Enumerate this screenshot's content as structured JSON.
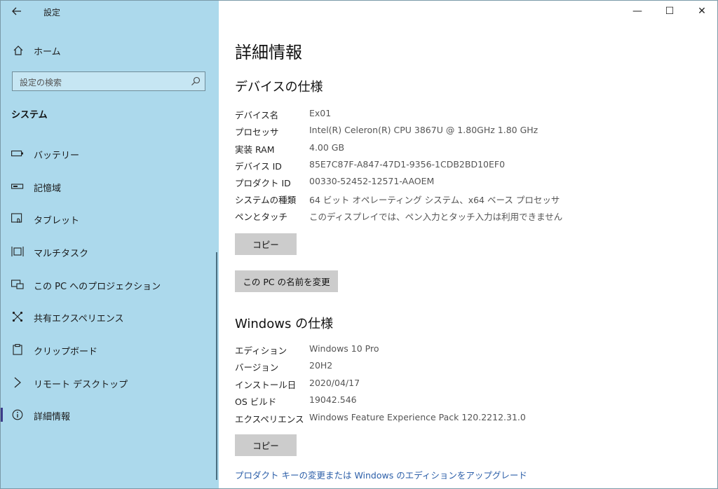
{
  "sidebar": {
    "back_icon": "back-arrow-icon",
    "app_title": "設定",
    "home_label": "ホーム",
    "search_placeholder": "設定の検索",
    "section": "システム",
    "items": [
      {
        "label": "バッテリー",
        "icon": "battery-icon"
      },
      {
        "label": "記憶域",
        "icon": "storage-icon"
      },
      {
        "label": "タブレット",
        "icon": "tablet-icon"
      },
      {
        "label": "マルチタスク",
        "icon": "multitask-icon"
      },
      {
        "label": "この PC へのプロジェクション",
        "icon": "projection-icon"
      },
      {
        "label": "共有エクスペリエンス",
        "icon": "shared-experience-icon"
      },
      {
        "label": "クリップボード",
        "icon": "clipboard-icon"
      },
      {
        "label": "リモート デスクトップ",
        "icon": "remote-desktop-icon"
      },
      {
        "label": "詳細情報",
        "icon": "info-icon",
        "active": true
      }
    ]
  },
  "window_controls": {
    "minimize": "—",
    "maximize": "☐",
    "close": "✕"
  },
  "main": {
    "title": "詳細情報",
    "device_spec": {
      "heading": "デバイスの仕様",
      "rows": [
        {
          "key": "デバイス名",
          "value": "Ex01"
        },
        {
          "key": "プロセッサ",
          "value": "Intel(R) Celeron(R) CPU 3867U @ 1.80GHz   1.80 GHz"
        },
        {
          "key": "実装 RAM",
          "value": "4.00 GB"
        },
        {
          "key": "デバイス ID",
          "value": "85E7C87F-A847-47D1-9356-1CDB2BD10EF0"
        },
        {
          "key": "プロダクト ID",
          "value": "00330-52452-12571-AAOEM"
        },
        {
          "key": "システムの種類",
          "value": "64 ビット オペレーティング システム、x64 ベース プロセッサ"
        },
        {
          "key": "ペンとタッチ",
          "value": "このディスプレイでは、ペン入力とタッチ入力は利用できません"
        }
      ],
      "copy_button": "コピー",
      "rename_button": "この PC の名前を変更"
    },
    "windows_spec": {
      "heading": "Windows の仕様",
      "rows": [
        {
          "key": "エディション",
          "value": "Windows 10 Pro"
        },
        {
          "key": "バージョン",
          "value": "20H2"
        },
        {
          "key": "インストール日",
          "value": "2020/04/17"
        },
        {
          "key": "OS ビルド",
          "value": "19042.546"
        },
        {
          "key": "エクスペリエンス",
          "value": "Windows Feature Experience Pack 120.2212.31.0"
        }
      ],
      "copy_button": "コピー"
    },
    "upgrade_link": "プロダクト キーの変更または Windows のエディションをアップグレード"
  }
}
